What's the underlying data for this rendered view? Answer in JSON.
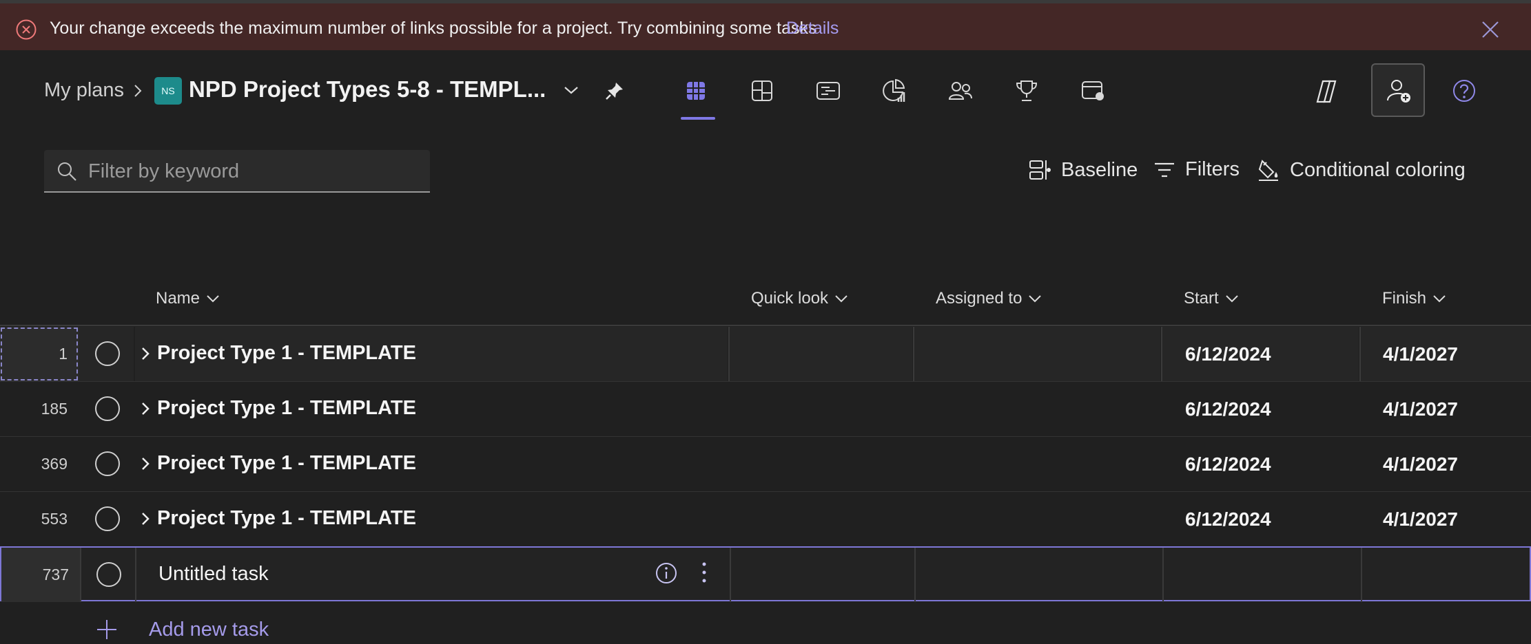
{
  "banner": {
    "message": "Your change exceeds the maximum number of links possible for a project. Try combining some tasks",
    "details_label": "Details",
    "icon": "error-circle-icon",
    "close_icon": "close-icon"
  },
  "header": {
    "breadcrumb_root": "My plans",
    "plan_badge": "NS",
    "plan_title": "NPD Project Types 5-8 - TEMPL...",
    "view_icons": [
      "grid-view-icon",
      "board-view-icon",
      "timeline-view-icon",
      "charts-view-icon",
      "people-view-icon",
      "goals-view-icon",
      "assignments-view-icon"
    ],
    "right_icons": [
      "copilot-icon",
      "share-person-add-icon",
      "help-icon"
    ]
  },
  "toolbar": {
    "filter_placeholder": "Filter by keyword",
    "baseline_label": "Baseline",
    "filters_label": "Filters",
    "conditional_coloring_label": "Conditional coloring"
  },
  "table": {
    "columns": {
      "name": "Name",
      "quick_look": "Quick look",
      "assigned_to": "Assigned to",
      "start": "Start",
      "finish": "Finish"
    },
    "rows": [
      {
        "num": "1",
        "name": "Project Type 1 - TEMPLATE",
        "start": "6/12/2024",
        "finish": "4/1/2027"
      },
      {
        "num": "185",
        "name": "Project Type 1 - TEMPLATE",
        "start": "6/12/2024",
        "finish": "4/1/2027"
      },
      {
        "num": "369",
        "name": "Project Type 1 - TEMPLATE",
        "start": "6/12/2024",
        "finish": "4/1/2027"
      },
      {
        "num": "553",
        "name": "Project Type 1 - TEMPLATE",
        "start": "6/12/2024",
        "finish": "4/1/2027"
      }
    ],
    "editing_row": {
      "num": "737",
      "name": "Untitled task"
    },
    "add_task_label": "Add new task"
  },
  "colors": {
    "accent": "#7f78e6",
    "banner_bg": "#442726",
    "background": "#202020",
    "link": "#a69cf0"
  }
}
